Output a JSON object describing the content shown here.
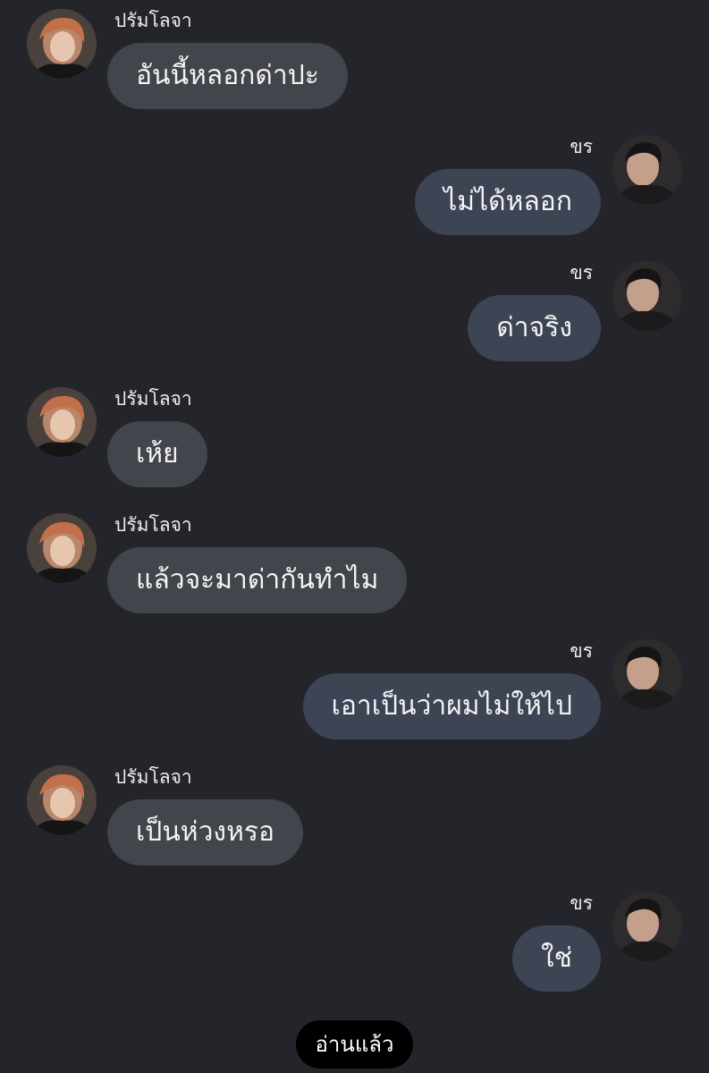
{
  "contacts": {
    "other": {
      "name": "ปรัมโลจา",
      "avatar": "avatar-ginger-hair"
    },
    "me": {
      "name": "ขร",
      "avatar": "avatar-dark-hair"
    }
  },
  "messages": [
    {
      "side": "left",
      "sender": "ปรัมโลจา",
      "text": "อันนี้หลอกด่าปะ"
    },
    {
      "side": "right",
      "sender": "ขร",
      "text": "ไม่ได้หลอก"
    },
    {
      "side": "right",
      "sender": "ขร",
      "text": "ด่าจริง"
    },
    {
      "side": "left",
      "sender": "ปรัมโลจา",
      "text": "เห้ย"
    },
    {
      "side": "left",
      "sender": "ปรัมโลจา",
      "text": "แล้วจะมาด่ากันทำไม"
    },
    {
      "side": "right",
      "sender": "ขร",
      "text": "เอาเป็นว่าผมไม่ให้ไป"
    },
    {
      "side": "left",
      "sender": "ปรัมโลจา",
      "text": "เป็นห่วงหรอ"
    },
    {
      "side": "right",
      "sender": "ขร",
      "text": "ใช่"
    }
  ],
  "status": {
    "read_label": "อ่านแล้ว"
  },
  "colors": {
    "background": "#24252b",
    "bubble_incoming": "#43454c",
    "bubble_outgoing": "#3d4453",
    "read_pill": "#000000"
  }
}
